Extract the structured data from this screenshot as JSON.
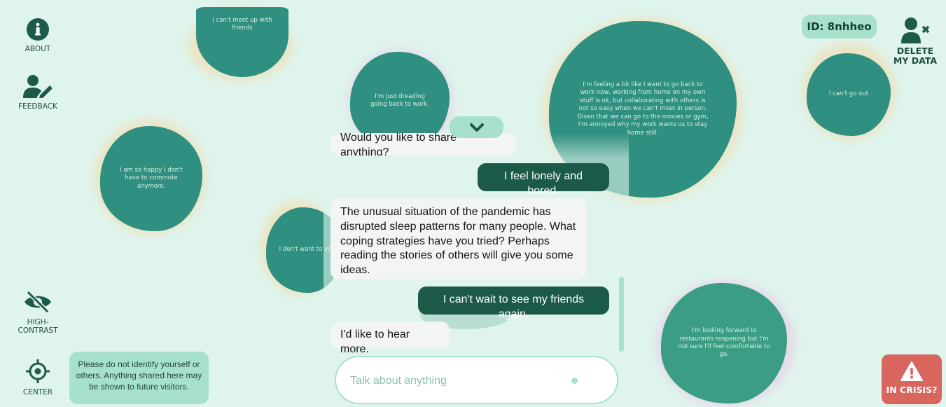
{
  "nav": {
    "about_label": "ABOUT",
    "feedback_label": "FEEDBACK",
    "high_contrast_label": "HIGH-\nCONTRAST",
    "center_label": "CENTER"
  },
  "header": {
    "session_id": "ID: 8nhheo",
    "delete_label": "DELETE\nMY DATA"
  },
  "notice_text": "Please do not identify yourself or others. Anything shared here may be shown to future visitors.",
  "stories": [
    "I can't meet up with friends",
    "I'm just dreading going back to work.",
    "I'm feeling a bit like I want to go back to work now, working from home on my own stuff is ok, but collaborating with others is not so easy when we can't meet in person. Given that we can go to the movies or gym, I'm annoyed why my work wants us to stay home still.",
    "I can't go out",
    "I am so happy I don't have to commute anymore.",
    "I don't want to yet.",
    "I'm looking forward to restaurants reopening but I'm not sure I'll feel comfortable to go."
  ],
  "chat": {
    "messages": [
      {
        "from": "bot",
        "text": "Would you like to share anything?"
      },
      {
        "from": "user",
        "text": "I feel lonely and bored."
      },
      {
        "from": "bot",
        "text": "The unusual situation of the pandemic has disrupted sleep patterns for many people. What coping strategies have you tried? Perhaps reading the stories of others will give you some ideas."
      },
      {
        "from": "user",
        "text": "I can't wait to see my friends again."
      },
      {
        "from": "bot",
        "text": "I'd like to hear more."
      }
    ],
    "input_placeholder": "Talk about anything",
    "input_value": ""
  },
  "crisis_label": "IN CRISIS?",
  "colors": {
    "background": "#dff4ec",
    "blob": "#2f8f80",
    "accent_soft": "#a7e1cc",
    "user_bubble": "#1b5a49",
    "crisis": "#d9665e"
  },
  "icons": [
    "info-icon",
    "feedback-icon",
    "eye-slash-icon",
    "crosshair-icon",
    "delete-user-icon",
    "chevron-down-icon",
    "warning-icon"
  ]
}
